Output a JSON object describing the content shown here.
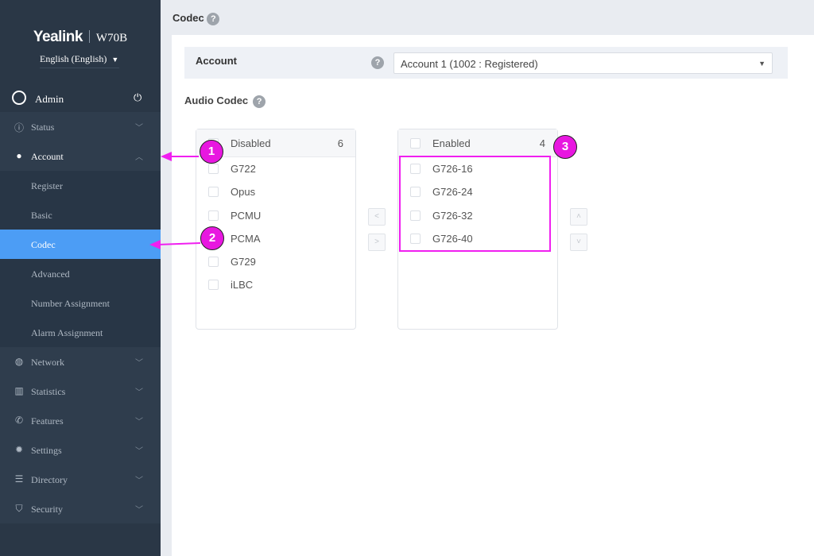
{
  "sidebar": {
    "brand": "Yealink",
    "model": "W70B",
    "language": "English (English)",
    "user": "Admin",
    "items": [
      {
        "label": "Status",
        "icon": "info-icon"
      },
      {
        "label": "Account",
        "icon": "user-icon"
      },
      {
        "label": "Network",
        "icon": "globe-icon"
      },
      {
        "label": "Statistics",
        "icon": "chart-icon"
      },
      {
        "label": "Features",
        "icon": "phone-icon"
      },
      {
        "label": "Settings",
        "icon": "gear-icon"
      },
      {
        "label": "Directory",
        "icon": "contacts-icon"
      },
      {
        "label": "Security",
        "icon": "shield-icon"
      }
    ],
    "account_sub": [
      "Register",
      "Basic",
      "Codec",
      "Advanced",
      "Number Assignment",
      "Alarm Assignment"
    ]
  },
  "header": {
    "title": "Codec"
  },
  "account": {
    "label": "Account",
    "value": "Account 1 (1002 : Registered)"
  },
  "audio_codec": {
    "label": "Audio Codec",
    "disabled": {
      "title": "Disabled",
      "count": "6",
      "items": [
        "G722",
        "Opus",
        "PCMU",
        "PCMA",
        "G729",
        "iLBC"
      ]
    },
    "enabled": {
      "title": "Enabled",
      "count": "4",
      "items": [
        "G726-16",
        "G726-24",
        "G726-32",
        "G726-40"
      ]
    }
  },
  "annotations": [
    "1",
    "2",
    "3"
  ],
  "colors": {
    "accent": "#4c9df5",
    "annotation": "#e817e0"
  }
}
